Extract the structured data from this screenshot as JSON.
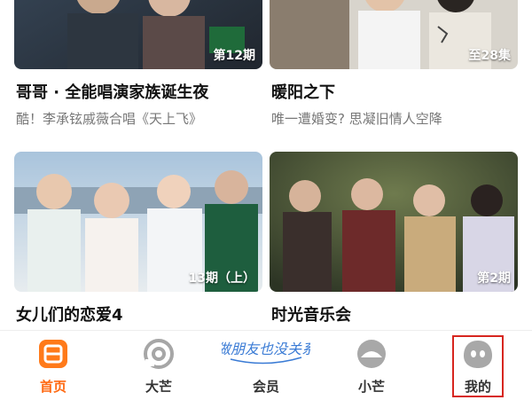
{
  "feed": {
    "cards": [
      {
        "badge": "第12期",
        "title": "哥哥 · 全能唱演家族诞生夜",
        "subtitle": "酷！李承铉戚薇合唱《天上飞》"
      },
      {
        "badge": "至28集",
        "title": "暖阳之下",
        "subtitle": "唯一遭婚变? 思凝旧情人空降"
      },
      {
        "badge": "13期（上）",
        "title": "女儿们的恋爱4",
        "subtitle": ""
      },
      {
        "badge": "第2期",
        "title": "时光音乐会",
        "subtitle": ""
      }
    ]
  },
  "tabbar": {
    "items": [
      {
        "label": "首页",
        "icon": "home-icon",
        "active": true
      },
      {
        "label": "大芒",
        "icon": "damang-icon",
        "active": false
      },
      {
        "label": "会员",
        "icon": "member-logo",
        "active": false
      },
      {
        "label": "小芒",
        "icon": "xiaomang-icon",
        "active": false
      },
      {
        "label": "我的",
        "icon": "profile-icon",
        "active": false
      }
    ],
    "member_logo_text": "做朋友也没关系"
  },
  "colors": {
    "accent": "#ff6a13",
    "highlight_border": "#d7261f"
  }
}
